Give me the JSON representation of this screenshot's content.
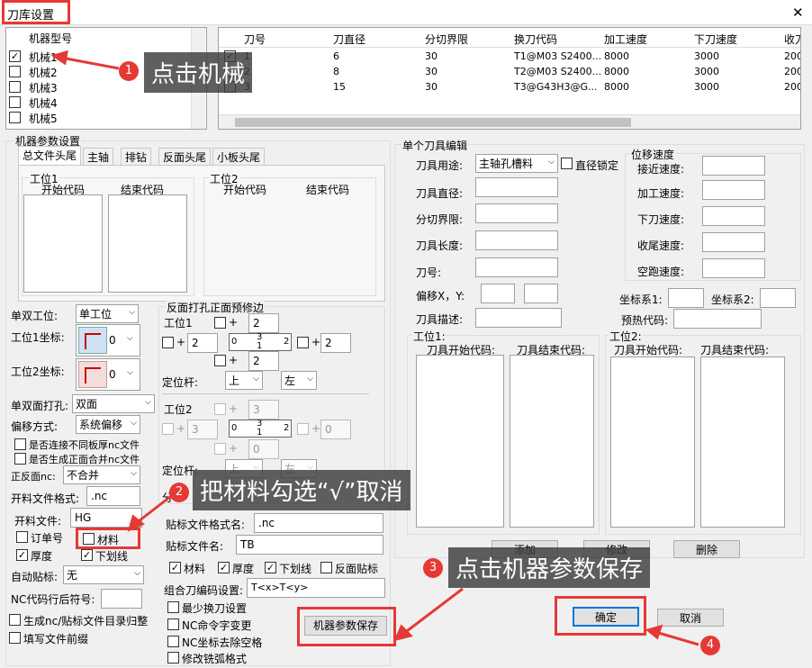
{
  "window": {
    "title": "刀库设置",
    "close": "✕"
  },
  "machine_list": {
    "header": "机器型号",
    "items": [
      {
        "label": "机械1",
        "checked": true
      },
      {
        "label": "机械2",
        "checked": false
      },
      {
        "label": "机械3",
        "checked": false
      },
      {
        "label": "机械4",
        "checked": false
      },
      {
        "label": "机械5",
        "checked": false
      }
    ]
  },
  "tool_table": {
    "headers": [
      "",
      "刀号",
      "刀直径",
      "分切界限",
      "换刀代码",
      "加工速度",
      "下刀速度",
      "收刀"
    ],
    "rows": [
      [
        "✓",
        "1",
        "6",
        "30",
        "T1@M03 S2400...",
        "8000",
        "3000",
        "200"
      ],
      [
        "",
        "2",
        "8",
        "30",
        "T2@M03 S2400...",
        "8000",
        "3000",
        "200"
      ],
      [
        "",
        "3",
        "15",
        "30",
        "T3@G43H3@G...",
        "8000",
        "3000",
        "200"
      ]
    ]
  },
  "params": {
    "title": "机器参数设置",
    "tabs": [
      "总文件头尾",
      "主轴",
      "排钻",
      "反面头尾",
      "小板头尾"
    ],
    "work1": {
      "title": "工位1",
      "start": "开始代码",
      "end": "结束代码"
    },
    "work2": {
      "title": "工位2",
      "start": "开始代码",
      "end": "结束代码"
    },
    "single_double_label": "单双工位:",
    "single_double_value": "单工位",
    "ws1_coord_label": "工位1坐标:",
    "ws1_coord_value": "0",
    "ws2_coord_label": "工位2坐标:",
    "ws2_coord_value": "0",
    "double_drill_label": "单双面打孔:",
    "double_drill_value": "双面",
    "offset_label": "偏移方式:",
    "offset_value": "系统偏移",
    "cb_connect": "是否连接不同板厚nc文件",
    "cb_merge": "是否生成正面合并nc文件",
    "front_back_label": "正反面nc:",
    "front_back_value": "不合并",
    "file_format_label": "开料文件格式:",
    "file_format_value": ".nc",
    "file_label": "开料文件:",
    "file_value": "HG",
    "cb_order": "订单号",
    "cb_material": "材料",
    "cb_thickness": "厚度",
    "cb_underline": "下划线",
    "auto_label_label": "自动贴标:",
    "auto_label_value": "无",
    "nc_suffix_label": "NC代码行后符号:",
    "cb_gen_dir": "生成nc/贴标文件目录归整",
    "cb_prefix": "填写文件前缀",
    "reverse": {
      "title": "反面打孔正面预修边",
      "ws1": "工位1",
      "ws2": "工位2",
      "plus": "+",
      "v2": "2",
      "v3": "3",
      "v0": "0",
      "grid_a": "0",
      "grid_b": "3",
      "grid_c": "1",
      "grid_d": "2",
      "pos_rod": "定位杆:",
      "pos_up": "上",
      "pos_left": "左",
      "cut": "分"
    },
    "label_format_label": "贴标文件格式名:",
    "label_format_value": ".nc",
    "label_file_label": "贴标文件名:",
    "label_file_value": "TB",
    "cb2_material": "材料",
    "cb2_thickness": "厚度",
    "cb2_underline": "下划线",
    "cb2_back": "反面贴标",
    "combo_code_label": "组合刀编码设置:",
    "combo_code_value": "T<x>T<y>",
    "cb_min_change": "最少换刀设置",
    "cb_nc_change": "NC命令字变更",
    "cb_nc_space": "NC坐标去除空格",
    "cb_arc": "修改铣弧格式",
    "save_button": "机器参数保存"
  },
  "single_tool": {
    "title": "单个刀具编辑",
    "use_label": "刀具用途:",
    "use_value": "主轴孔槽料",
    "dia_lock": "直径锁定",
    "dia_label": "刀具直径:",
    "cut_label": "分切界限:",
    "len_label": "刀具长度:",
    "num_label": "刀号:",
    "offset_label": "偏移X，Y:",
    "desc_label": "刀具描述:",
    "move_title": "位移速度",
    "approach": "接近速度:",
    "process": "加工速度:",
    "down": "下刀速度:",
    "retract": "收尾速度:",
    "idle": "空跑速度:",
    "coord1": "坐标系1:",
    "coord2": "坐标系2:",
    "preheat": "预热代码:",
    "w1_title": "工位1:",
    "w2_title": "工位2:",
    "tool_start": "刀具开始代码:",
    "tool_end": "刀具结束代码:",
    "add": "添加",
    "modify": "修改",
    "delete": "删除"
  },
  "footer": {
    "ok": "确定",
    "cancel": "取消"
  },
  "annotations": {
    "c1": "点击机械",
    "c2": "把材料勾选“√”取消",
    "c3": "点击机器参数保存",
    "n1": "1",
    "n2": "2",
    "n3": "3",
    "n4": "4"
  },
  "colors": {
    "accent": "#e53935",
    "callout": "#3c3c3c"
  }
}
